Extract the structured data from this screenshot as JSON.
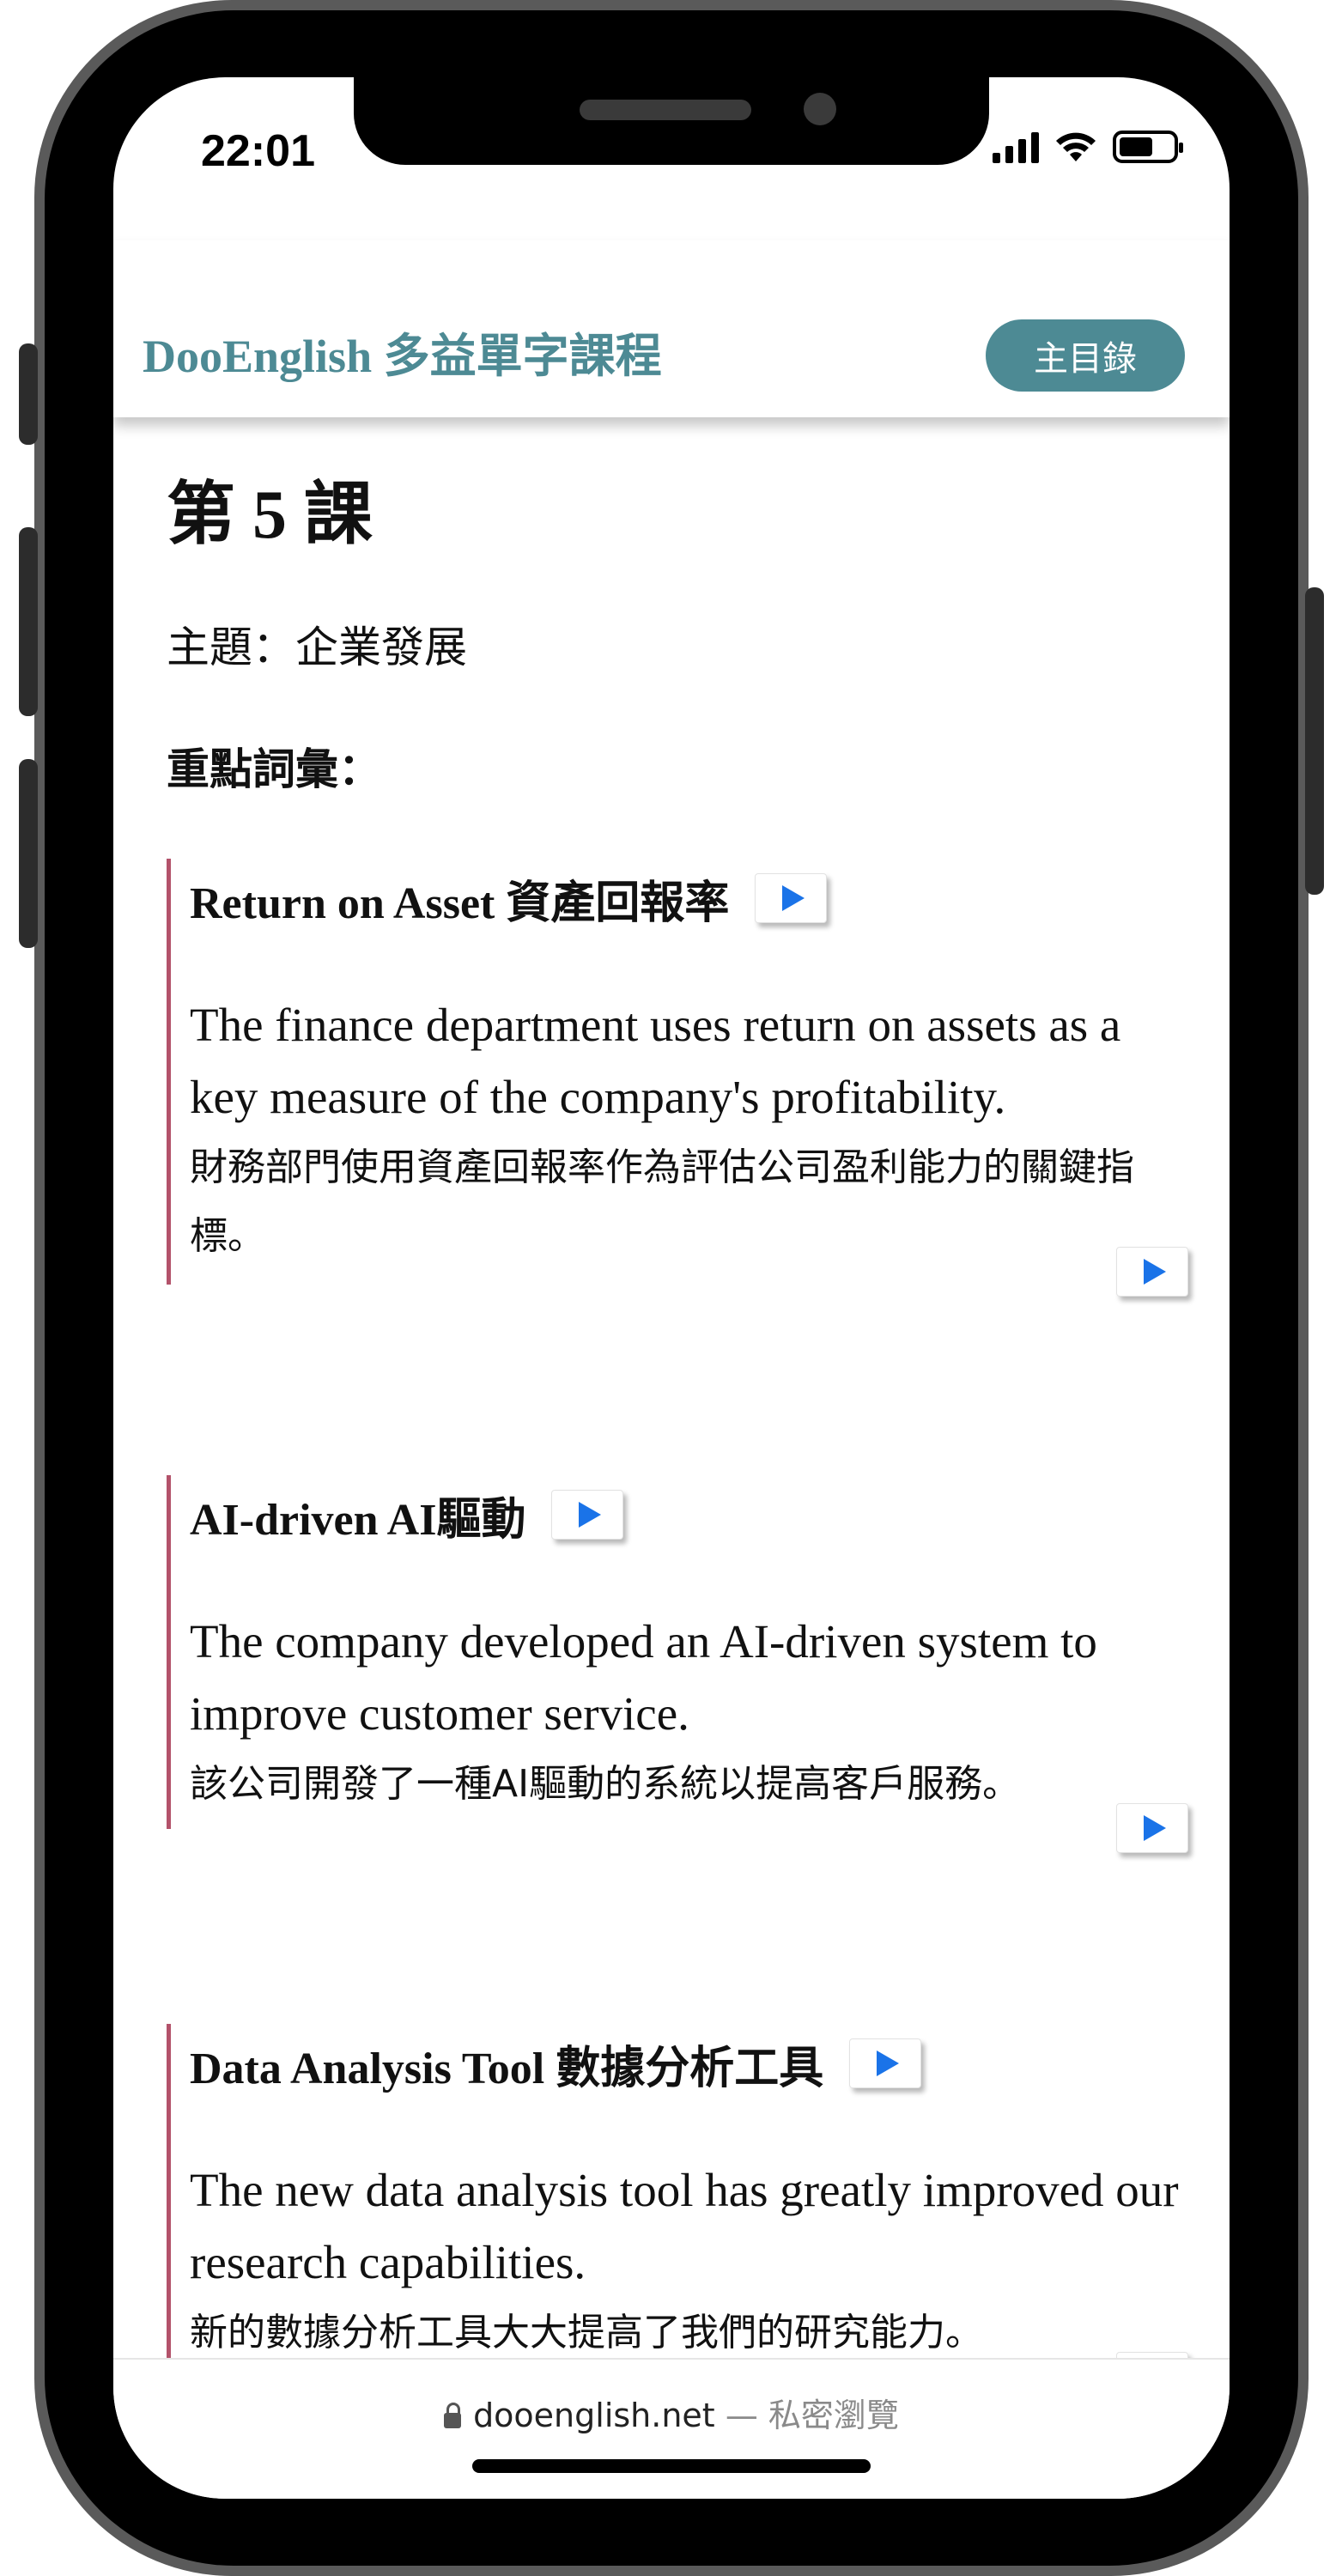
{
  "status_bar": {
    "time": "22:01"
  },
  "header": {
    "site_title": "DooEnglish 多益單字課程",
    "menu_button_label": "主目錄",
    "accent_color": "#4d8a94"
  },
  "lesson": {
    "title": "第 5 課",
    "topic": "主題：企業發展",
    "key_vocab_label": "重點詞彙："
  },
  "vocab_items": [
    {
      "term": "Return on Asset 資產回報率",
      "sentence_en": "The finance department uses return on assets as a key measure of the company's profitability.",
      "sentence_zh": "財務部門使用資產回報率作為評估公司盈利能力的關鍵指標。"
    },
    {
      "term": "AI-driven AI驅動",
      "sentence_en": "The company developed an AI-driven system to improve customer service.",
      "sentence_zh": "該公司開發了一種AI驅動的系統以提高客戶服務。"
    },
    {
      "term": "Data Analysis Tool 數據分析工具",
      "sentence_en": "The new data analysis tool has greatly improved our research capabilities.",
      "sentence_zh": "新的數據分析工具大大提高了我們的研究能力。"
    }
  ],
  "browser": {
    "url_host": "dooenglish.net",
    "separator": "—",
    "mode": "私密瀏覽"
  },
  "icons": {
    "play": "play-icon",
    "lock": "lock-icon",
    "signal": "signal-icon",
    "wifi": "wifi-icon",
    "battery": "battery-icon"
  }
}
